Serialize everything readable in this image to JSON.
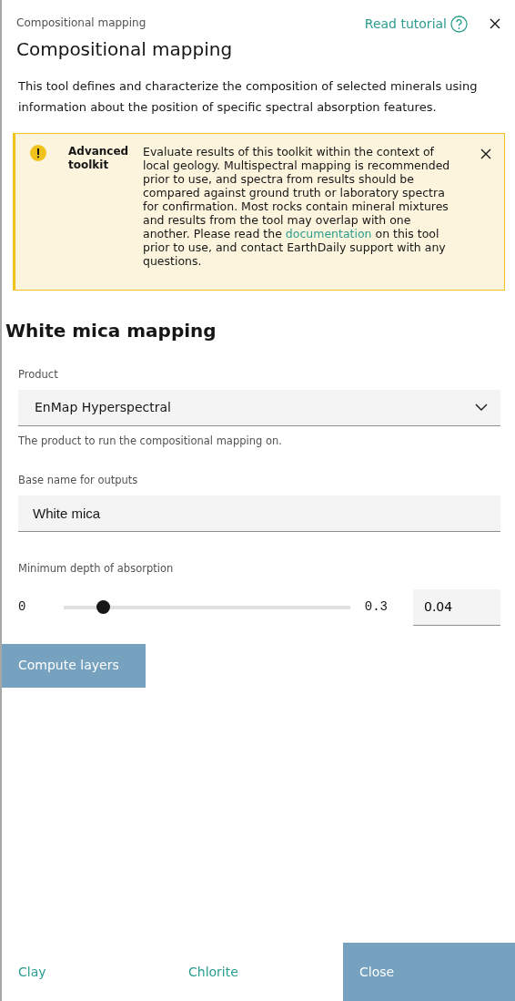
{
  "header": {
    "eyebrow": "Compositional mapping",
    "tutorial_link": "Read tutorial",
    "title": "Compositional mapping"
  },
  "description": "This tool defines and characterize the composition of selected minerals using information about the position of specific spectral absorption features.",
  "notice": {
    "kind": "warning",
    "title": "Advanced toolkit",
    "text_before": "Evaluate results of this toolkit within the context of local geology. Multispectral mapping is recommended prior to use, and spectra from results should be compared against ground truth or laboratory spectra for confirmation. Most rocks contain mineral mixtures and results from the tool may overlap with one another. Please read the",
    "link": "documentation",
    "text_after": "on this tool prior to use, and contact EarthDaily support with any questions."
  },
  "section_title": "White mica mapping",
  "product": {
    "label": "Product",
    "value": "EnMap Hyperspectral",
    "helper": "The product to run the compositional mapping on."
  },
  "base_name": {
    "label": "Base name for outputs",
    "value": "White mica"
  },
  "min_depth": {
    "label": "Minimum depth of absorption",
    "min": "0",
    "max": "0.3",
    "level": 0.135,
    "value": "0.04"
  },
  "compute_button": "Compute layers",
  "footer": [
    {
      "label": "Clay",
      "kind": "link"
    },
    {
      "label": "Chlorite",
      "kind": "link"
    },
    {
      "label": "Close",
      "kind": "primary"
    }
  ]
}
